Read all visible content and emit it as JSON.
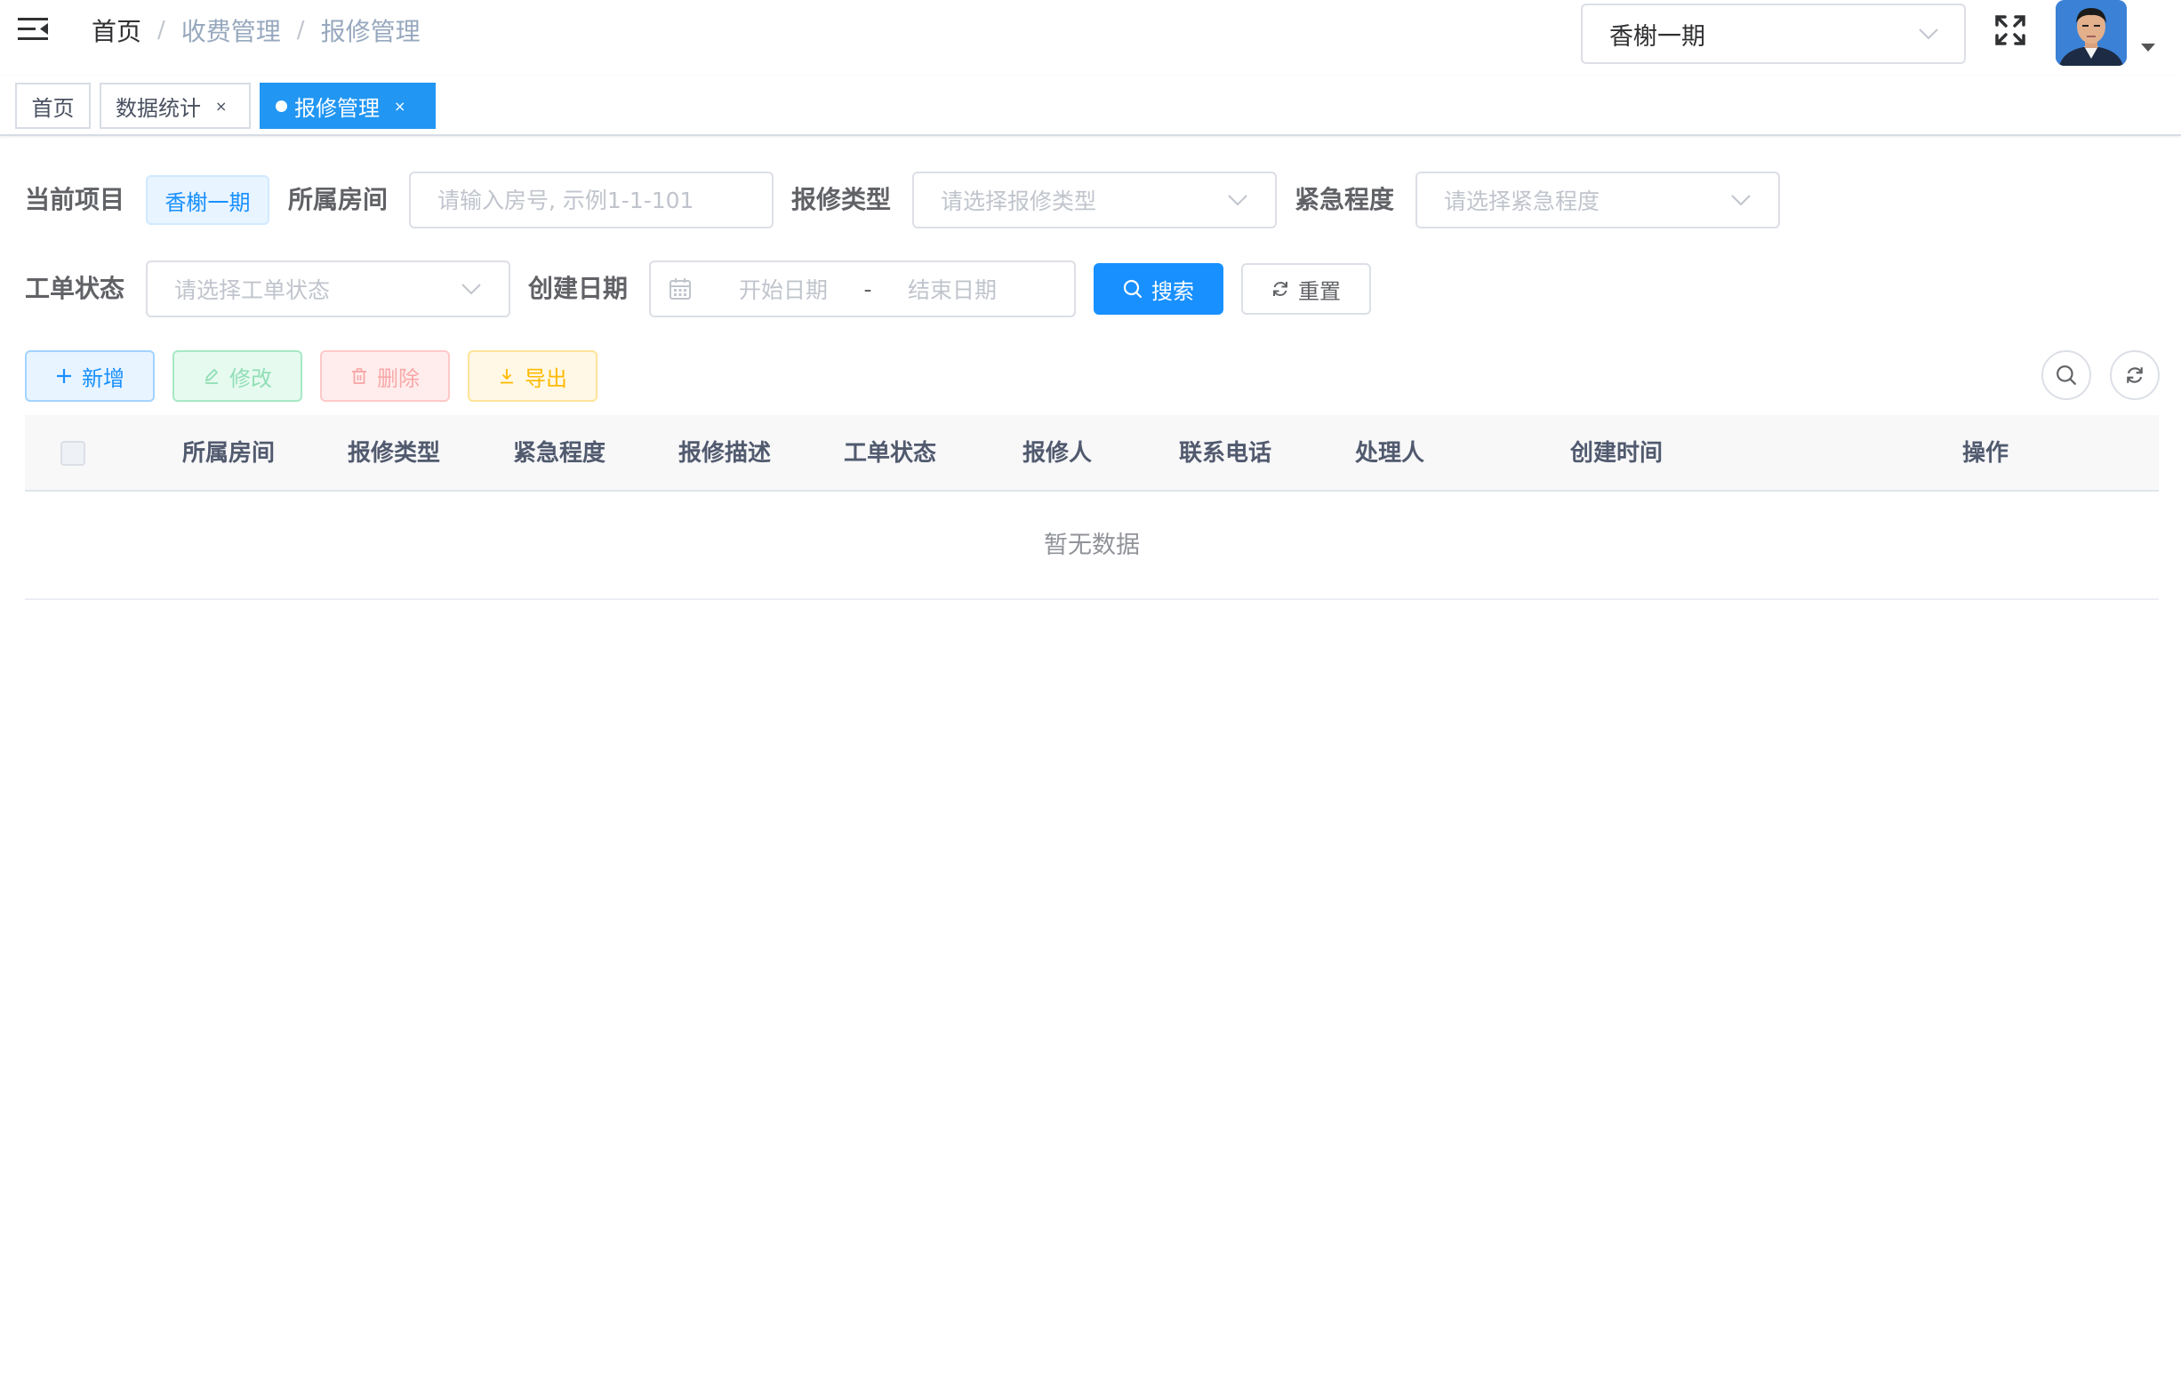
{
  "navbar": {
    "breadcrumb": [
      "首页",
      "收费管理",
      "报修管理"
    ],
    "breadcrumb_separator": "/",
    "project_select_value": "香榭一期"
  },
  "tags": [
    {
      "label": "首页",
      "closable": false,
      "active": false
    },
    {
      "label": "数据统计",
      "closable": true,
      "active": false
    },
    {
      "label": "报修管理",
      "closable": true,
      "active": true
    }
  ],
  "tag_close_glyph": "×",
  "search": {
    "current_project_label": "当前项目",
    "current_project_value": "香榭一期",
    "room_label": "所属房间",
    "room_placeholder": "请输入房号, 示例1-1-101",
    "repair_type_label": "报修类型",
    "repair_type_placeholder": "请选择报修类型",
    "urgency_label": "紧急程度",
    "urgency_placeholder": "请选择紧急程度",
    "status_label": "工单状态",
    "status_placeholder": "请选择工单状态",
    "date_label": "创建日期",
    "date_start_placeholder": "开始日期",
    "date_separator": "-",
    "date_end_placeholder": "结束日期",
    "search_button": "搜索",
    "reset_button": "重置"
  },
  "toolbar": {
    "add": "新增",
    "edit": "修改",
    "delete": "删除",
    "export": "导出"
  },
  "table": {
    "columns": [
      "所属房间",
      "报修类型",
      "紧急程度",
      "报修描述",
      "工单状态",
      "报修人",
      "联系电话",
      "处理人",
      "创建时间",
      "操作"
    ],
    "empty_text": "暂无数据"
  },
  "colors": {
    "primary": "#1890ff",
    "tag_active": "#2196f3",
    "success": "#13ce66",
    "danger": "#ff4949",
    "warning": "#ffba00"
  },
  "icons": {
    "hamburger": "hamburger-icon",
    "fullscreen": "fullscreen-icon",
    "calendar": "calendar-icon",
    "search": "search-icon",
    "refresh": "refresh-icon",
    "plus": "plus-icon",
    "edit": "edit-icon",
    "delete": "trash-icon",
    "export": "download-icon",
    "chevron": "chevron-down-icon"
  }
}
